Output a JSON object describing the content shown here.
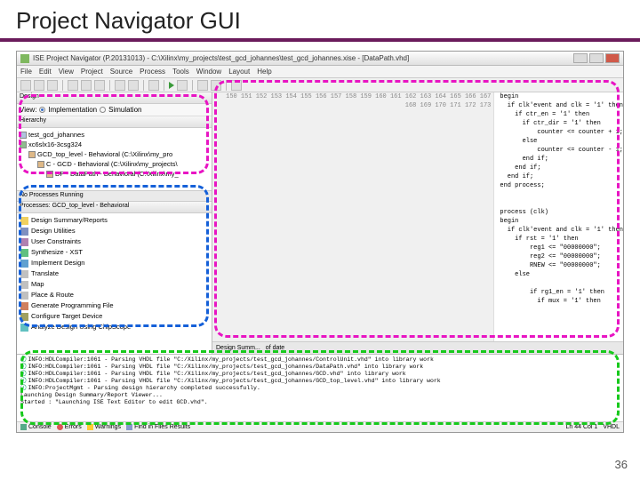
{
  "slide": {
    "title": "Project Navigator GUI",
    "page_number": "36"
  },
  "titlebar": {
    "text": "ISE Project Navigator (P.20131013) - C:\\Xilinx\\my_projects\\test_gcd_johannes\\test_gcd_johannes.xise - [DataPath.vhd]"
  },
  "menubar": [
    "File",
    "Edit",
    "View",
    "Project",
    "Source",
    "Process",
    "Tools",
    "Window",
    "Layout",
    "Help"
  ],
  "left": {
    "design_hdr": "Design",
    "view_label": "View:",
    "impl_label": "Implementation",
    "sim_label": "Simulation",
    "hierarchy_hdr": "Hierarchy",
    "tree": {
      "proj": "test_gcd_johannes",
      "device": "xc6slx16-3csg324",
      "top": "GCD_top_level - Behavioral (C:\\Xilinx\\my_pro",
      "c": "C - GCD - Behavioral (C:\\Xilinx\\my_projects\\",
      "dp": "DP - DataPath - Behavioral (C:\\Xilinx\\my_"
    },
    "proc_hdr": "Processes: GCD_top_level - Behavioral",
    "processes": {
      "p1": "Design Summary/Reports",
      "p2": "Design Utilities",
      "p3": "User Constraints",
      "p4": "Synthesize - XST",
      "p5": "Implement Design",
      "p5a": "Translate",
      "p5b": "Map",
      "p5c": "Place & Route",
      "p6": "Generate Programming File",
      "p7": "Configure Target Device",
      "p8": "Analyze Design Using ChipScope"
    }
  },
  "editor": {
    "lines_start": 150,
    "code": [
      "begin",
      "  if clk'event and clk = '1' then",
      "    if ctr_en = '1' then",
      "      if ctr_dir = '1' then",
      "          counter <= counter + 1;",
      "      else",
      "          counter <= counter - 1;",
      "      end if;",
      "    end if;",
      "  end if;",
      "end process;",
      "",
      "",
      "process (clk)",
      "begin",
      "  if clk'event and clk = '1' then",
      "    if rst = '1' then",
      "        reg1 <= \"00000000\";",
      "        reg2 <= \"00000000\";",
      "        RNEW <= \"00000000\";",
      "    else",
      "",
      "        if rg1_en = '1' then",
      "          if mux = '1' then"
    ],
    "tabs": [
      "Design Summ...",
      "of date",
      "...",
      "..."
    ]
  },
  "console": {
    "l1": "INFO:HDLCompiler:1061 - Parsing VHDL file \"C:/Xilinx/my_projects/test_gcd_johannes/ControlUnit.vhd\" into library work",
    "l2": "INFO:HDLCompiler:1061 - Parsing VHDL file \"C:/Xilinx/my_projects/test_gcd_johannes/DataPath.vhd\" into library work",
    "l3": "INFO:HDLCompiler:1061 - Parsing VHDL file \"C:/Xilinx/my_projects/test_gcd_johannes/GCD.vhd\" into library work",
    "l4": "INFO:HDLCompiler:1061 - Parsing VHDL file \"C:/Xilinx/my_projects/test_gcd_johannes/GCD_top_level.vhd\" into library work",
    "l5": "INFO:ProjectMgmt - Parsing design hierarchy completed successfully.",
    "l6": "Launching Design Summary/Report Viewer...",
    "l7": "",
    "l8": "Started : \"Launching ISE Text Editor to edit GCD.vhd\"."
  },
  "bottom_tabs": {
    "console": "Console",
    "errors": "Errors",
    "warnings": "Warnings",
    "find": "Find in Files Results"
  },
  "status": {
    "pos": "Ln 44 Col 1",
    "lang": "VHDL"
  }
}
